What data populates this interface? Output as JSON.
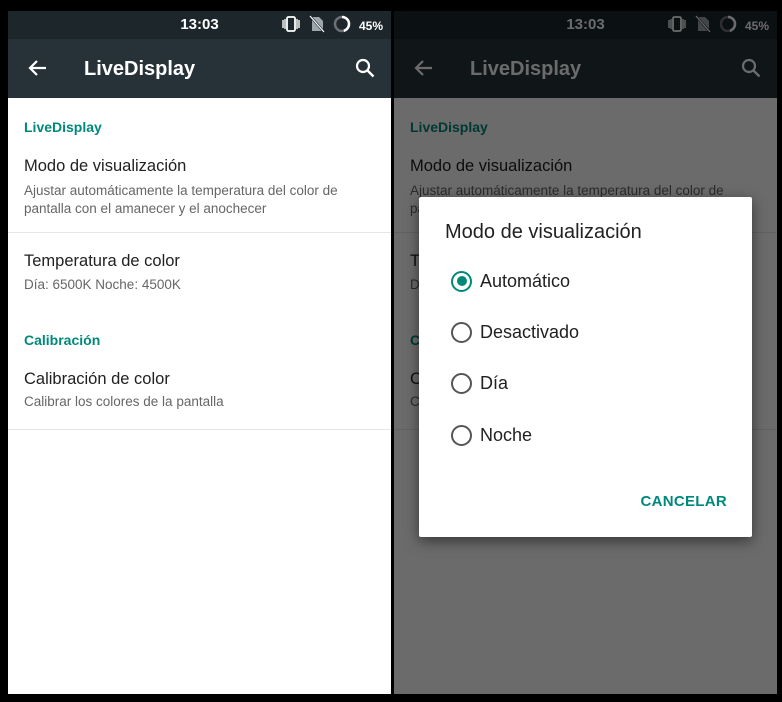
{
  "status_bar": {
    "time": "13:03",
    "battery": "45%"
  },
  "app_bar": {
    "title": "LiveDisplay"
  },
  "sections": {
    "livedisplay_header": "LiveDisplay",
    "calibration_header": "Calibración"
  },
  "items": {
    "display_mode": {
      "title": "Modo de visualización",
      "summary": "Ajustar automáticamente la temperatura del color de pantalla con el amanecer y el anochecer"
    },
    "color_temperature": {
      "title": "Temperatura de color",
      "summary": "Día: 6500K Noche: 4500K"
    },
    "color_calibration": {
      "title": "Calibración de color",
      "summary": "Calibrar los colores de la pantalla"
    }
  },
  "dialog": {
    "title": "Modo de visualización",
    "options": [
      {
        "label": "Automático",
        "selected": true
      },
      {
        "label": "Desactivado",
        "selected": false
      },
      {
        "label": "Día",
        "selected": false
      },
      {
        "label": "Noche",
        "selected": false
      }
    ],
    "cancel_label": "CANCELAR"
  },
  "colors": {
    "accent": "#00897b",
    "toolbar": "#263238",
    "status_bar": "#1c262b"
  }
}
